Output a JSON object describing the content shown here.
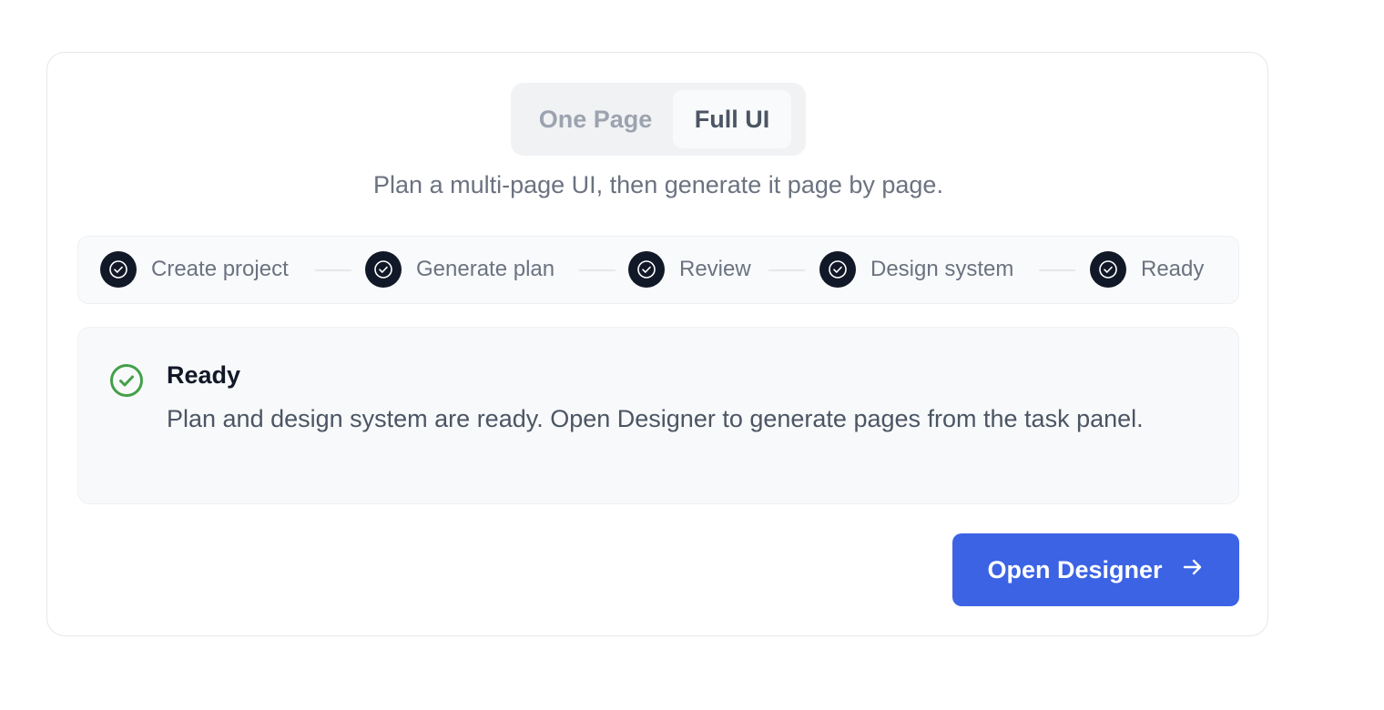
{
  "mode_toggle": {
    "options": [
      "One Page",
      "Full UI"
    ],
    "selected": "Full UI"
  },
  "subtitle": "Plan a multi-page UI, then generate it page by page.",
  "steps": [
    {
      "label": "Create project",
      "status": "done"
    },
    {
      "label": "Generate plan",
      "status": "done"
    },
    {
      "label": "Review",
      "status": "done"
    },
    {
      "label": "Design system",
      "status": "done"
    },
    {
      "label": "Ready",
      "status": "done"
    }
  ],
  "status_panel": {
    "icon": "check-circle-icon",
    "title": "Ready",
    "message": "Plan and design system are ready. Open Designer to generate pages from the task panel."
  },
  "primary_action": {
    "label": "Open Designer",
    "icon": "arrow-right-icon"
  },
  "colors": {
    "step_done": "#111827",
    "success": "#43a047",
    "primary": "#3b63e4"
  }
}
